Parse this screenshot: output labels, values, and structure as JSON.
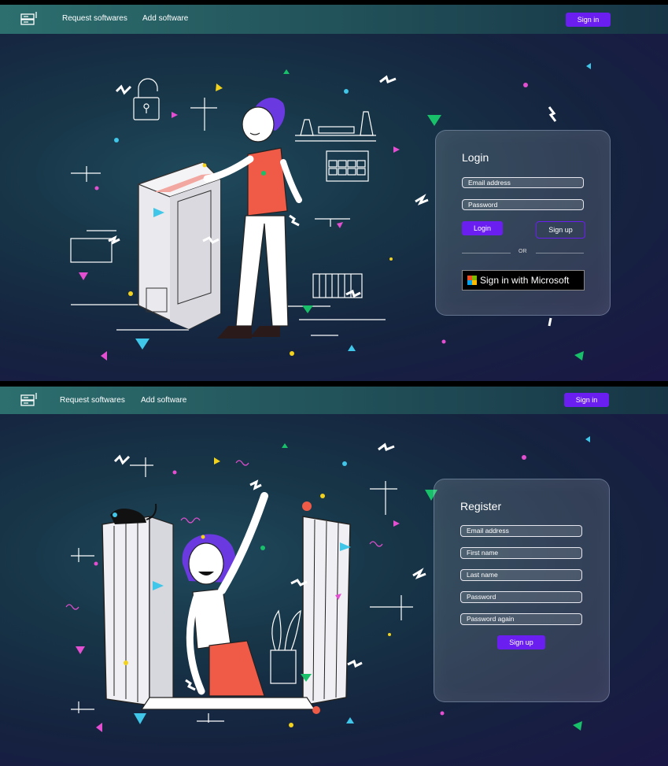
{
  "login_screen": {
    "nav": {
      "links": [
        "Request softwares",
        "Add software"
      ],
      "signin_label": "Sign in"
    },
    "card": {
      "title": "Login",
      "email_placeholder": "Email address",
      "password_placeholder": "Password",
      "login_label": "Login",
      "signup_label": "Sign up",
      "or_text": "OR",
      "microsoft_label": "Sign in with Microsoft"
    }
  },
  "register_screen": {
    "nav": {
      "links": [
        "Request softwares",
        "Add software"
      ],
      "signin_label": "Sign in"
    },
    "card": {
      "title": "Register",
      "fields": [
        "Email address",
        "First name",
        "Last name",
        "Password",
        "Password again"
      ],
      "signup_label": "Sign up"
    }
  },
  "colors": {
    "accent": "#6a1ff0",
    "nav_start": "#2d6f6f",
    "background": "#15233f",
    "skin_shirt": "#ef5b47",
    "hair": "#6a3ae0"
  },
  "icons": [
    "server-logo-icon",
    "microsoft-logo-icon"
  ]
}
